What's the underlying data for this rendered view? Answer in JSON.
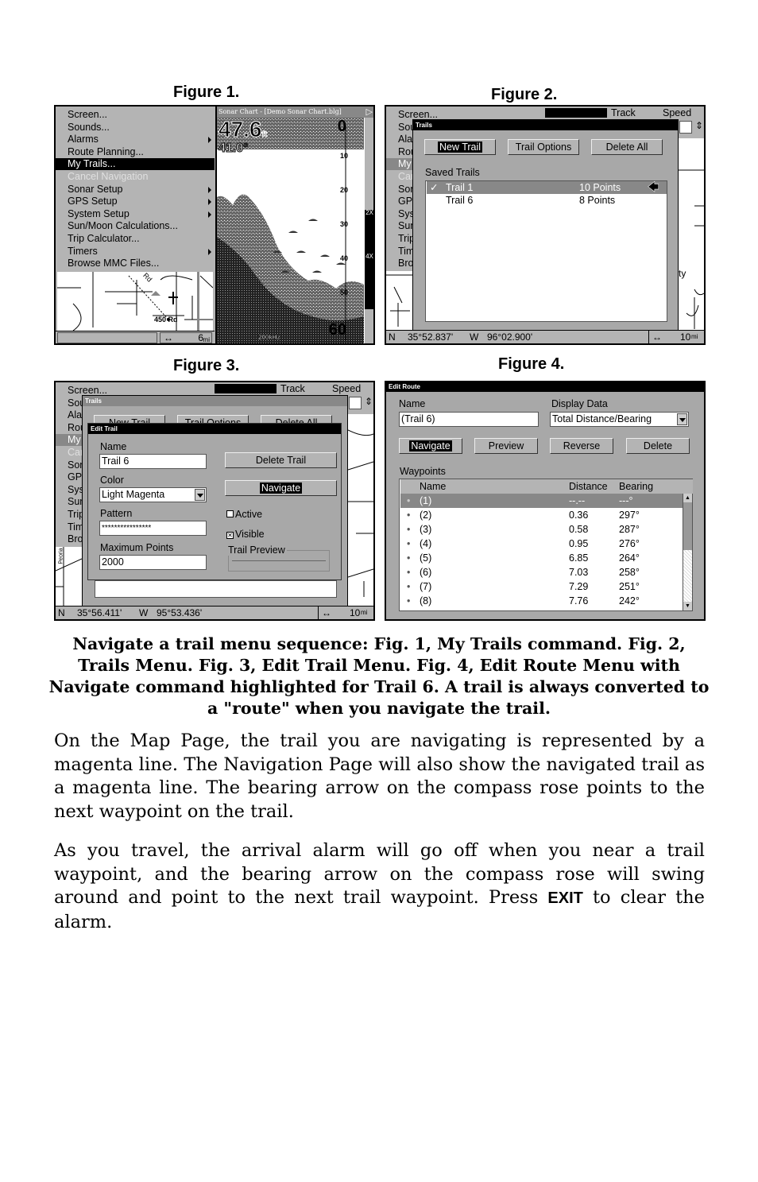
{
  "figure_labels": [
    "Figure 1.",
    "Figure 2.",
    "Figure 3.",
    "Figure 4."
  ],
  "fig1": {
    "menu_items": [
      {
        "label": "Screen...",
        "submenu": false
      },
      {
        "label": "Sounds...",
        "submenu": false
      },
      {
        "label": "Alarms",
        "submenu": true
      },
      {
        "label": "Route Planning...",
        "submenu": false
      },
      {
        "label": "My Trails...",
        "submenu": false,
        "selected": true
      },
      {
        "label": "Cancel Navigation",
        "submenu": false,
        "disabled": true
      },
      {
        "label": "Sonar Setup",
        "submenu": true
      },
      {
        "label": "GPS Setup",
        "submenu": true
      },
      {
        "label": "System Setup",
        "submenu": true
      },
      {
        "label": "Sun/Moon Calculations...",
        "submenu": false
      },
      {
        "label": "Trip Calculator...",
        "submenu": false
      },
      {
        "label": "Timers",
        "submenu": true
      },
      {
        "label": "Browse MMC Files...",
        "submenu": false
      }
    ],
    "map_label": "450 Rd",
    "map_road": "Rd",
    "scale": "6",
    "scale_unit": "mi",
    "sonar": {
      "title": "Sonar Chart - [Demo Sonar Chart.blg]",
      "depth": "47.6",
      "depth_unit": "ft",
      "temperature": "41.0°",
      "depth_scale": [
        "0",
        "10",
        "20",
        "30",
        "40",
        "50",
        "60"
      ],
      "frequency": "200kHz",
      "zoom_levels": [
        "2X",
        "4X"
      ]
    }
  },
  "fig2": {
    "top_headers": [
      "Track",
      "Speed"
    ],
    "menu_items": [
      "Screen...",
      "Sounds...",
      "Alarms",
      "Route Planning...",
      "My Trails...",
      "Cancel Navigation",
      "Sonar Setup",
      "GPS Setup",
      "System Setup",
      "Sun/Moon Calculations...",
      "Trip Calculator...",
      "Timers",
      "Browse MMC Files..."
    ],
    "dialog_title": "Trails",
    "buttons": [
      "New Trail",
      "Trail Options",
      "Delete All"
    ],
    "saved_trails_label": "Saved Trails",
    "trails": [
      {
        "name": "Trail 1",
        "points": "10 Points",
        "checked": true,
        "selected": true
      },
      {
        "name": "Trail 6",
        "points": "8 Points",
        "checked": false,
        "selected": false
      }
    ],
    "map_text": "ty",
    "status": {
      "lat_hemi": "N",
      "lat": "35°52.837'",
      "lon_hemi": "W",
      "lon": "96°02.900'",
      "scale": "10",
      "scale_unit": "mi"
    }
  },
  "fig3": {
    "top_headers": [
      "Track",
      "Speed"
    ],
    "trails_title": "Trails",
    "trails_buttons": [
      "New Trail",
      "Trail Options",
      "Delete All"
    ],
    "dialog_title": "Edit Trail",
    "name_label": "Name",
    "name_value": "Trail 6",
    "color_label": "Color",
    "color_value": "Light Magenta",
    "pattern_label": "Pattern",
    "pattern_value": "****************",
    "max_points_label": "Maximum Points",
    "max_points_value": "2000",
    "delete_button": "Delete Trail",
    "navigate_button": "Navigate",
    "active_label": "Active",
    "active_checked": false,
    "visible_label": "Visible",
    "visible_checked": true,
    "preview_label": "Trail Preview",
    "map_text": "Peoria",
    "status": {
      "lat_hemi": "N",
      "lat": "35°56.411'",
      "lon_hemi": "W",
      "lon": "95°53.436'",
      "scale": "10",
      "scale_unit": "mi"
    }
  },
  "fig4": {
    "dialog_title": "Edit Route",
    "name_label": "Name",
    "name_value": "(Trail 6)",
    "display_label": "Display Data",
    "display_value": "Total Distance/Bearing",
    "buttons": [
      "Navigate",
      "Preview",
      "Reverse",
      "Delete"
    ],
    "waypoints_label": "Waypoints",
    "columns": [
      "Name",
      "Distance",
      "Bearing"
    ],
    "rows": [
      {
        "name": "(1)",
        "distance": "--.--",
        "bearing": "---°"
      },
      {
        "name": "(2)",
        "distance": "0.36",
        "bearing": "297°"
      },
      {
        "name": "(3)",
        "distance": "0.58",
        "bearing": "287°"
      },
      {
        "name": "(4)",
        "distance": "0.95",
        "bearing": "276°"
      },
      {
        "name": "(5)",
        "distance": "6.85",
        "bearing": "264°"
      },
      {
        "name": "(6)",
        "distance": "7.03",
        "bearing": "258°"
      },
      {
        "name": "(7)",
        "distance": "7.29",
        "bearing": "251°"
      },
      {
        "name": "(8)",
        "distance": "7.76",
        "bearing": "242°"
      }
    ]
  },
  "caption": "Navigate a trail menu sequence: Fig. 1, My Trails command. Fig. 2, Trails Menu. Fig. 3, Edit Trail Menu. Fig. 4, Edit Route Menu with Navigate command highlighted for Trail 6. A trail is always converted to a \"route\" when you navigate the trail.",
  "paragraph1": "On the Map Page, the trail you are navigating is represented by a magenta line. The Navigation Page will also show the navigated trail as a magenta line. The bearing arrow on the compass rose points to the next waypoint on the trail.",
  "paragraph2_before": "As you travel, the arrival alarm will go off when you near a trail waypoint, and the bearing arrow on the compass rose will swing around and point to the next trail waypoint. Press",
  "paragraph2_key": "EXIT",
  "paragraph2_after": "to clear the alarm."
}
